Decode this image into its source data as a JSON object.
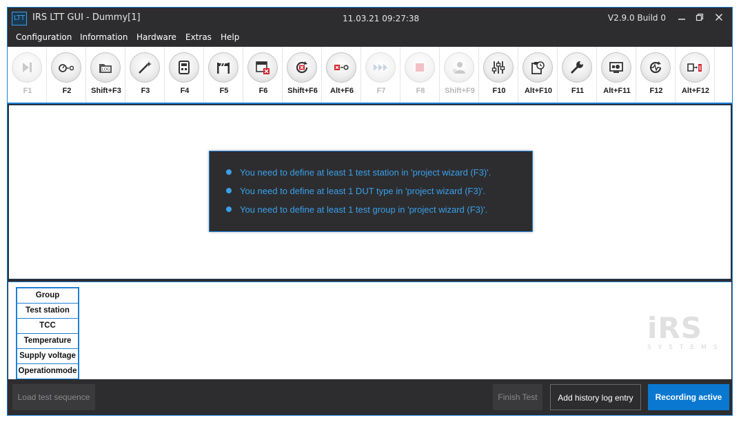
{
  "titlebar": {
    "app_icon": "LTT",
    "title": "IRS LTT GUI - Dummy[1]",
    "clock": "11.03.21 09:27:38",
    "version": "V2.9.0 Build 0",
    "minimize_icon": "minimize-icon",
    "maximize_icon": "restore-icon",
    "close_icon": "close-icon"
  },
  "menu": [
    "Configuration",
    "Information",
    "Hardware",
    "Extras",
    "Help"
  ],
  "toolbar": [
    {
      "label": "F1",
      "icon": "play-skip-icon",
      "enabled": false
    },
    {
      "label": "F2",
      "icon": "stopwatch-reset-icon",
      "enabled": true
    },
    {
      "label": "Shift+F3",
      "icon": "log-folder-icon",
      "enabled": true
    },
    {
      "label": "F3",
      "icon": "magic-wand-icon",
      "enabled": true
    },
    {
      "label": "F4",
      "icon": "calculator-icon",
      "enabled": true
    },
    {
      "label": "F5",
      "icon": "barrier-icon",
      "enabled": true
    },
    {
      "label": "F6",
      "icon": "calendar-delete-icon",
      "enabled": true
    },
    {
      "label": "Shift+F6",
      "icon": "reset-circle-icon",
      "enabled": true
    },
    {
      "label": "Alt+F6",
      "icon": "clear-zero-icon",
      "enabled": true
    },
    {
      "label": "F7",
      "icon": "fast-forward-icon",
      "enabled": false
    },
    {
      "label": "F8",
      "icon": "stop-icon",
      "enabled": false
    },
    {
      "label": "Shift+F9",
      "icon": "user-delete-icon",
      "enabled": false
    },
    {
      "label": "F10",
      "icon": "sliders-icon",
      "enabled": true
    },
    {
      "label": "Alt+F10",
      "icon": "clipboard-clock-icon",
      "enabled": true
    },
    {
      "label": "F11",
      "icon": "wrench-icon",
      "enabled": true
    },
    {
      "label": "Alt+F11",
      "icon": "monitor-settings-icon",
      "enabled": true
    },
    {
      "label": "F12",
      "icon": "heartbeat-refresh-icon",
      "enabled": true
    },
    {
      "label": "Alt+F12",
      "icon": "transfer-delete-icon",
      "enabled": true
    }
  ],
  "messages": [
    "You need to define at least 1 test station in 'project wizard (F3)'.",
    "You need to define at least 1 DUT type in 'project wizard (F3)'.",
    "You need to define at least 1 test group in 'project wizard (F3)'."
  ],
  "info_table": [
    "Group",
    "Test station",
    "TCC",
    "Temperature",
    "Supply voltage",
    "Operationmode"
  ],
  "logo": {
    "main": "iRS",
    "sub": "SYSTEMS"
  },
  "footer": {
    "load_label": "Load test sequence",
    "finish_label": "Finish Test",
    "history_label": "Add history log entry",
    "recording_label": "Recording active"
  },
  "colors": {
    "accent": "#1c7fd6",
    "message_text": "#3aa0e8",
    "window_bg": "#2d2d30",
    "primary_button": "#0a78d0"
  }
}
